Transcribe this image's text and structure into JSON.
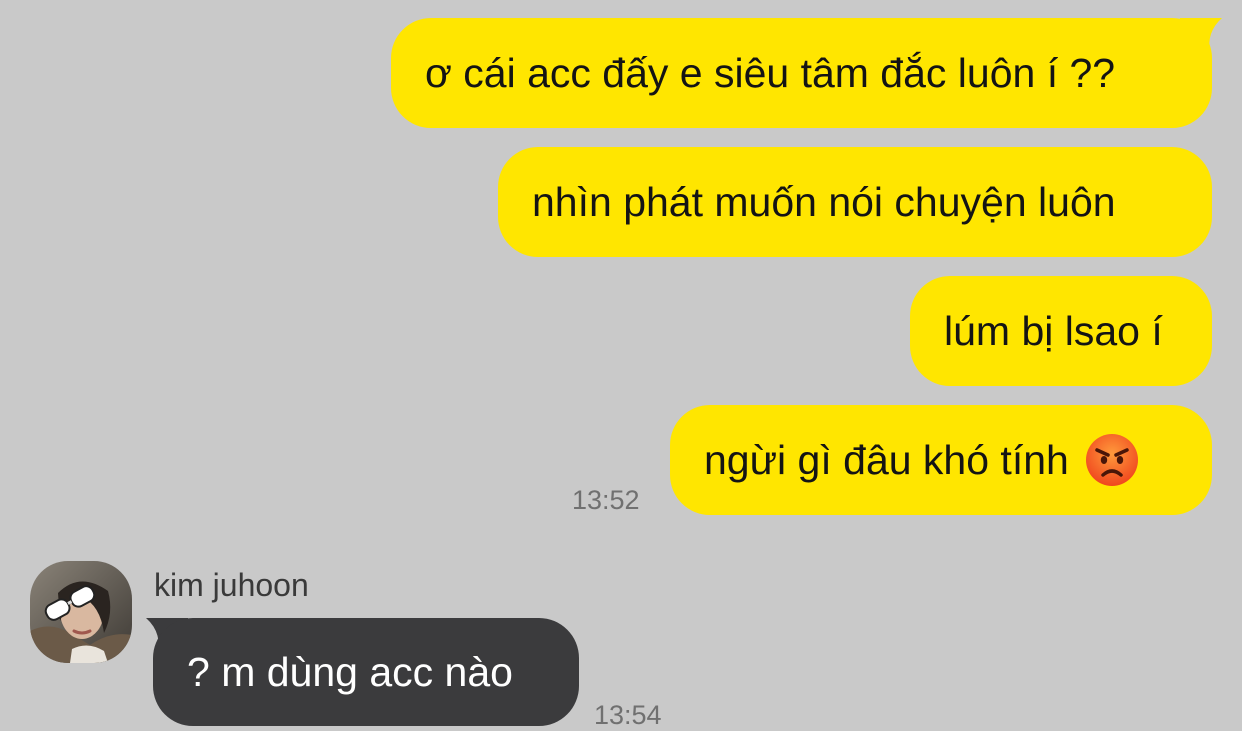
{
  "conversation": {
    "outgoing": [
      {
        "text": "ơ cái acc đấy e siêu tâm đắc luôn í ??"
      },
      {
        "text": "nhìn phát muốn nói chuyện luôn"
      },
      {
        "text": "lúm bị lsao í"
      },
      {
        "text": "ngừi gì đâu khó tính",
        "emoji": "angry-face-emoji"
      }
    ],
    "outgoing_time": "13:52",
    "incoming": {
      "sender": "kim juhoon",
      "avatar": "profile-avatar",
      "text": "? m dùng acc nào",
      "time": "13:54"
    }
  },
  "colors": {
    "background": "#c9c9c9",
    "outgoing_bubble": "#ffe600",
    "incoming_bubble": "#3b3b3d"
  }
}
